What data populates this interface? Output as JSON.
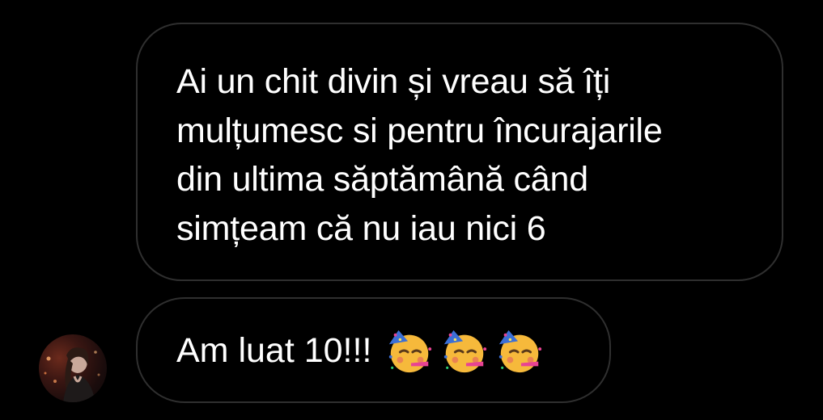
{
  "messages": [
    {
      "text": "Ai un chit divin și vreau să îți\nmulțumesc si pentru încurajarile\ndin ultima săptămână când\nsimțeam că nu iau nici 6"
    },
    {
      "text": "Am luat 10!!!",
      "emojis": [
        "partying-face-emoji",
        "partying-face-emoji",
        "partying-face-emoji"
      ]
    }
  ],
  "colors": {
    "background": "#000000",
    "bubble_border": "#2f2f2f",
    "text": "#ffffff"
  },
  "avatar": {
    "icon": "user-avatar"
  }
}
